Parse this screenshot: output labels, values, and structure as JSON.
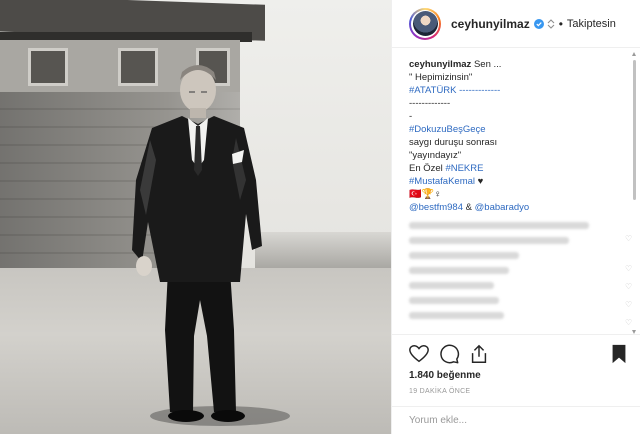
{
  "post": {
    "username": "ceyhunyilmaz",
    "separator": "•",
    "follow_status": "Takiptesin"
  },
  "caption": {
    "user": "ceyhunyilmaz",
    "lines": [
      "Sen ...",
      "\" Hepimizinsin\"",
      "#ATATÜRK -------------",
      "-------------",
      "-",
      "#DokuzuBeşGeçe",
      "saygı duruşu sonrası",
      "\"yayındayız\"",
      "En Özel",
      "#NEKRE",
      "#MustafaKemal",
      "♥",
      "🇹🇷🏆♀",
      "@bestfm984",
      "&",
      "@babaradyo"
    ]
  },
  "stats": {
    "likes": "1.840 beğenme",
    "time_ago": "19 DAKİKA ÖNCE"
  },
  "comment": {
    "placeholder": "Yorum ekle..."
  },
  "icons": {
    "verified": "verified-badge-icon",
    "more": "more-options-icon",
    "like": "heart-icon",
    "comment": "comment-icon",
    "share": "share-icon",
    "save": "bookmark-icon"
  },
  "colors": {
    "verified_blue": "#3897f0",
    "hashtag_blue": "#2e6ac1",
    "text": "#262626",
    "muted": "#999999"
  }
}
